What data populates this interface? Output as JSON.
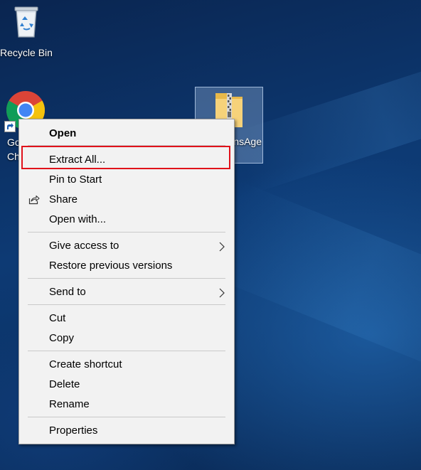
{
  "desktop": {
    "icons": [
      {
        "label": "Recycle Bin",
        "icon": "recycle-bin-icon"
      },
      {
        "label": "Go\nCh",
        "icon": "chrome-icon",
        "shortcut": true
      },
      {
        "label": "nsAge",
        "icon": "zip-folder-icon",
        "selected": true
      }
    ]
  },
  "context_menu": {
    "items": [
      {
        "label": "Open",
        "bold": true
      },
      {
        "label": "Extract All...",
        "highlighted": true
      },
      {
        "label": "Pin to Start"
      },
      {
        "label": "Share",
        "icon": "share-icon"
      },
      {
        "label": "Open with..."
      },
      {
        "label": "Give access to",
        "submenu": true
      },
      {
        "label": "Restore previous versions"
      },
      {
        "label": "Send to",
        "submenu": true
      },
      {
        "label": "Cut"
      },
      {
        "label": "Copy"
      },
      {
        "label": "Create shortcut"
      },
      {
        "label": "Delete"
      },
      {
        "label": "Rename"
      },
      {
        "label": "Properties"
      }
    ]
  },
  "colors": {
    "menu_background": "#f2f2f2",
    "highlight_border": "#e0121b",
    "desktop_background": "#0d3a74"
  }
}
